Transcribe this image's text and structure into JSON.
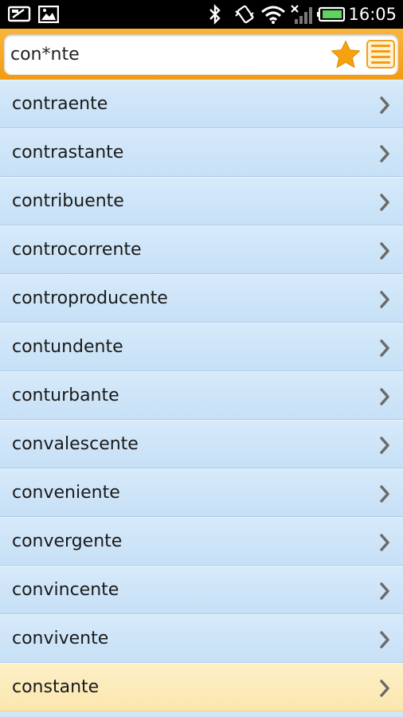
{
  "status_bar": {
    "time": "16:05"
  },
  "search": {
    "query": "con*nte"
  },
  "results": [
    {
      "label": "contraente",
      "highlighted": false
    },
    {
      "label": "contrastante",
      "highlighted": false
    },
    {
      "label": "contribuente",
      "highlighted": false
    },
    {
      "label": "controcorrente",
      "highlighted": false
    },
    {
      "label": "controproducente",
      "highlighted": false
    },
    {
      "label": "contundente",
      "highlighted": false
    },
    {
      "label": "conturbante",
      "highlighted": false
    },
    {
      "label": "convalescente",
      "highlighted": false
    },
    {
      "label": "conveniente",
      "highlighted": false
    },
    {
      "label": "convergente",
      "highlighted": false
    },
    {
      "label": "convincente",
      "highlighted": false
    },
    {
      "label": "convivente",
      "highlighted": false
    },
    {
      "label": "constante",
      "highlighted": true
    }
  ],
  "colors": {
    "accent": "#f39c12",
    "list_bg": "#d2e6f6",
    "highlight_bg": "#fdf0c8"
  },
  "icons": [
    "screen-icon",
    "image-icon",
    "bluetooth-icon",
    "vibrate-icon",
    "wifi-icon",
    "no-signal-icon",
    "battery-icon",
    "star-icon",
    "menu-icon",
    "chevron-right-icon"
  ]
}
